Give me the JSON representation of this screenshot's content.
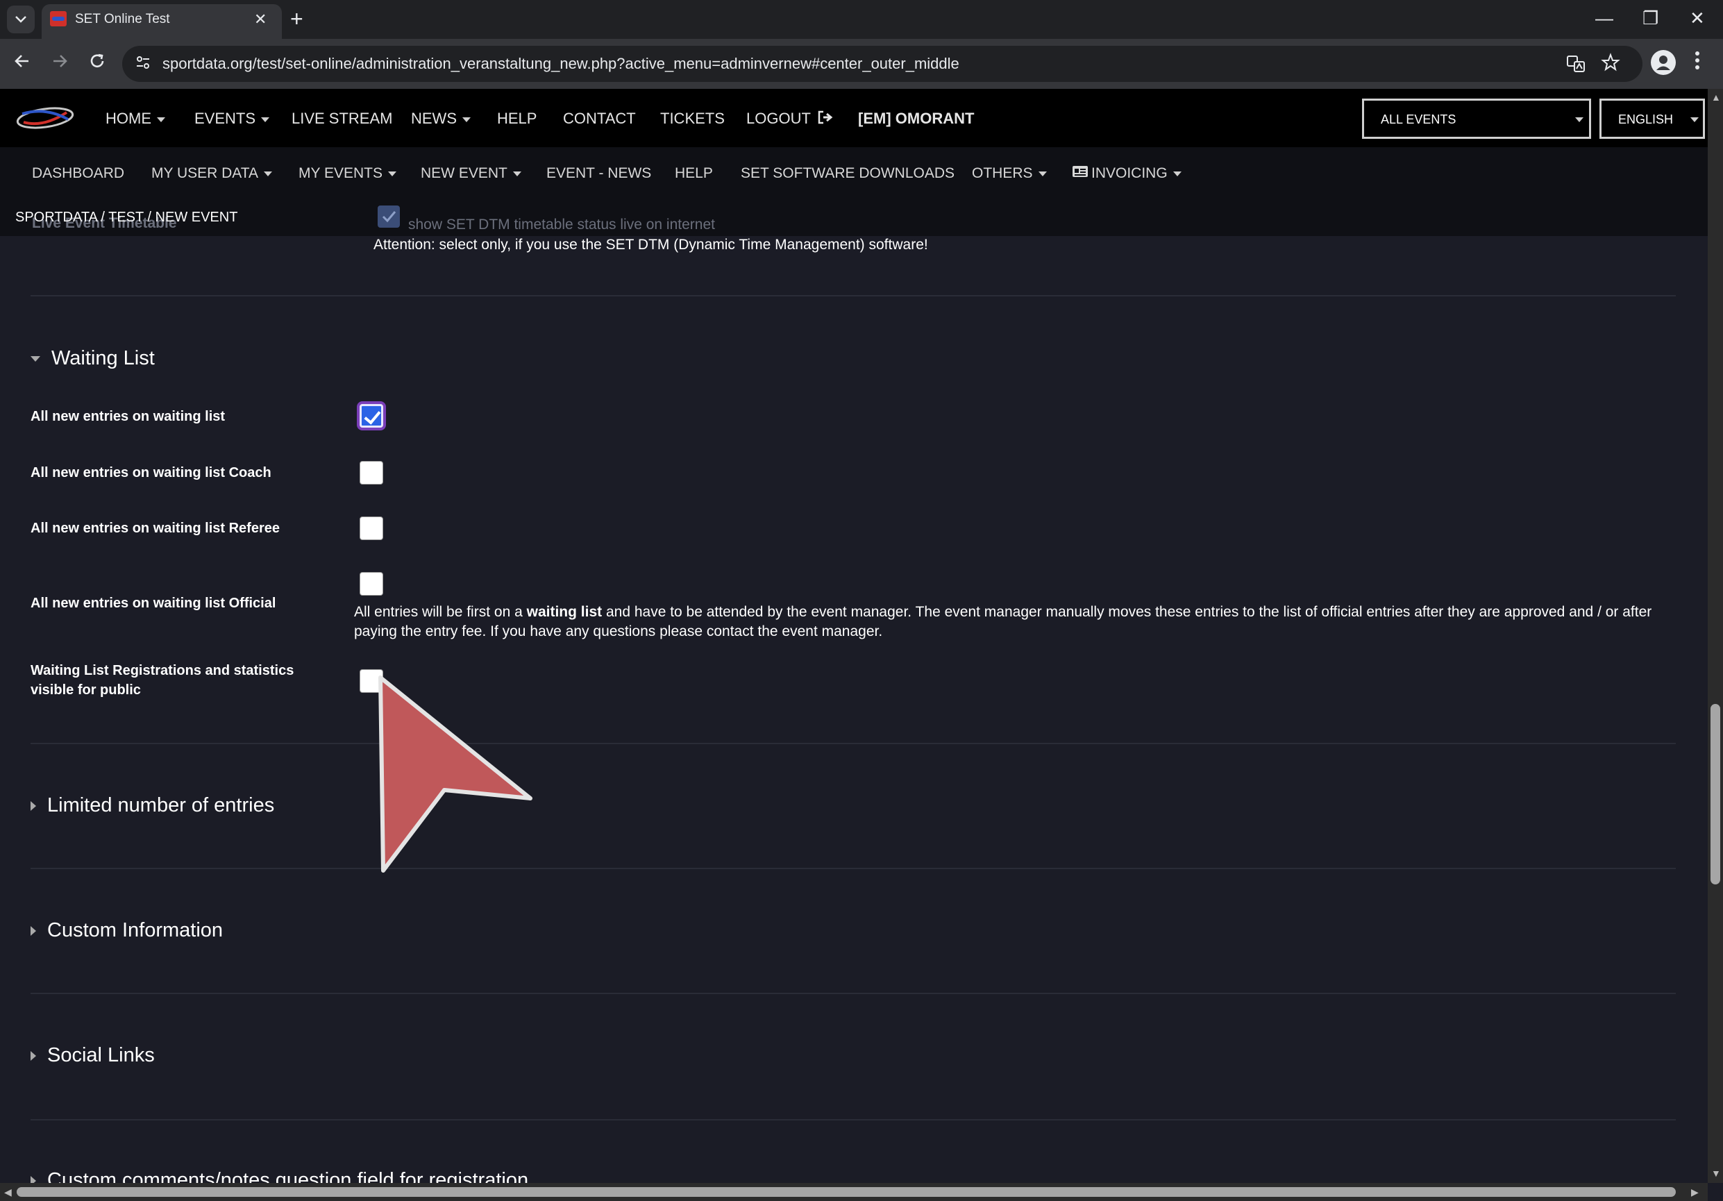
{
  "browser": {
    "tab_title": "SET Online Test",
    "tab_close": "✕",
    "new_tab": "+",
    "window_controls": [
      "—",
      "❐",
      "✕"
    ],
    "url": "sportdata.org/test/set-online/administration_veranstaltung_new.php?active_menu=adminvernew#center_outer_middle",
    "icons": [
      "tab-dropdown-icon",
      "back-icon",
      "forward-icon",
      "reload-icon",
      "site-info-icon",
      "translate-icon",
      "star-icon",
      "profile-icon",
      "menu-icon"
    ]
  },
  "main_nav": {
    "items": [
      "HOME",
      "EVENTS",
      "LIVE STREAM",
      "NEWS",
      "HELP",
      "CONTACT",
      "TICKETS",
      "LOGOUT"
    ],
    "user": "[EM] OMORANT",
    "events_select": "ALL EVENTS",
    "language_select": "ENGLISH"
  },
  "sub_nav": {
    "items": [
      "DASHBOARD",
      "MY USER DATA",
      "MY EVENTS",
      "NEW EVENT",
      "EVENT - NEWS",
      "HELP",
      "SET SOFTWARE DOWNLOADS",
      "OTHERS",
      "INVOICING"
    ]
  },
  "breadcrumb": "SPORTDATA /  TEST /  NEW EVENT",
  "live_timetable": {
    "title": "Live Event Timetable",
    "checkbox_label": "show SET DTM timetable status live on internet",
    "attention": "Attention: select only, if you use the SET DTM (Dynamic Time Management) software!"
  },
  "waiting_list": {
    "title": "Waiting List",
    "fields": [
      {
        "label": "All new entries on waiting list",
        "checked": true
      },
      {
        "label": "All new entries on waiting list Coach",
        "checked": false
      },
      {
        "label": "All new entries on waiting list Referee",
        "checked": false
      },
      {
        "label": "All new entries on waiting list Official",
        "checked": false
      },
      {
        "label": "Waiting List Registrations and statistics visible for public",
        "checked": false
      }
    ],
    "info_before": "All entries will be first on a ",
    "info_bold": "waiting list",
    "info_after": " and have to be attended by the event manager. The event manager manually moves these entries to the list of official entries after they are approved and / or after paying the entry fee. If you have any questions please contact the event manager."
  },
  "sections": [
    "Limited number of entries",
    "Custom Information",
    "Social Links",
    "Custom comments/notes question field for registration"
  ],
  "colors": {
    "page_bg": "#1b1c26",
    "nav_bg": "#000000",
    "checkbox_checked": "#2b63e6",
    "cursor": "#c0585a"
  }
}
